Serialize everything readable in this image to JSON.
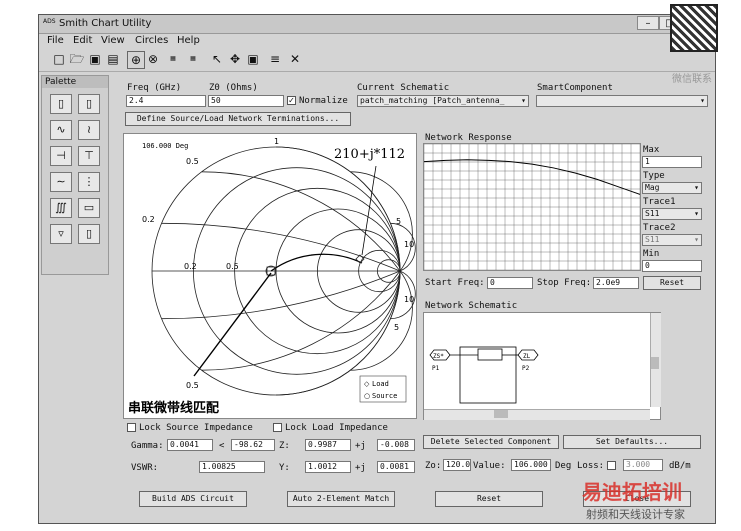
{
  "window": {
    "title": "Smith Chart Utility",
    "logo_text": "ADS"
  },
  "menu": [
    "File",
    "Edit",
    "View",
    "Circles",
    "Help"
  ],
  "palette": {
    "title": "Palette"
  },
  "freq": {
    "label": "Freq (GHz)",
    "value": "2.4"
  },
  "z0": {
    "label": "Z0 (Ohms)",
    "value": "50"
  },
  "normalize": {
    "label": "Normalize",
    "checked": true
  },
  "schematic": {
    "label": "Current Schematic",
    "value": "patch_matching [Patch_antenna_"
  },
  "smart_component": {
    "label": "SmartComponent",
    "value": ""
  },
  "define_button": "Define Source/Load Network Terminations...",
  "smith": {
    "deg_label": "106.000 Deg",
    "labels": [
      "0.5",
      "1",
      "0.2",
      "0.2",
      "0.5",
      "5",
      "10",
      "10",
      "5",
      "0.5"
    ],
    "annotation": "210+j*112",
    "caption": "串联微带线匹配",
    "legend": [
      "Load",
      "Source"
    ]
  },
  "network_response": {
    "title": "Network Response",
    "max_label": "Max",
    "max_value": "1",
    "type_label": "Type",
    "type_value": "Mag",
    "trace1_label": "Trace1",
    "trace1_value": "S11",
    "trace2_label": "Trace2",
    "trace2_value": "S11",
    "min_label": "Min",
    "min_value": "0",
    "start_label": "Start Freq:",
    "start_value": "0",
    "stop_label": "Stop Freq:",
    "stop_value": "2.0e9",
    "reset_label": "Reset"
  },
  "network_schematic": {
    "title": "Network Schematic",
    "p1_label": "ZS*",
    "p1_name": "P1",
    "p2_label": "ZL",
    "p2_name": "P2"
  },
  "lock_source": "Lock Source Impedance",
  "lock_load": "Lock Load Impedance",
  "gamma": {
    "label": "Gamma:",
    "mag": "0.0041",
    "angle_symbol": "<",
    "angle": "-98.62"
  },
  "z_values": {
    "label": "Z:",
    "real": "0.9987",
    "j": "+j",
    "imag": "-0.008"
  },
  "vswr": {
    "label": "VSWR:",
    "value": "1.00825"
  },
  "y_values": {
    "label": "Y:",
    "real": "1.0012",
    "j": "+j",
    "imag": "0.0081"
  },
  "delete_button": "Delete Selected Component",
  "defaults_button": "Set Defaults...",
  "component": {
    "zo_label": "Zo:",
    "zo_value": "120.0",
    "value_label": "Value:",
    "value": "106.000",
    "unit": "Deg",
    "loss_label": "Loss:",
    "loss_value": "3.000",
    "loss_unit": "dB/m"
  },
  "bottom": {
    "build": "Build ADS Circuit",
    "auto": "Auto 2-Element Match",
    "reset": "Reset",
    "close": "Close"
  },
  "watermarks": {
    "top_right": "微信联系",
    "brand": "易迪拓培训",
    "brand_sub": "射频和天线设计专家"
  },
  "chart_data": {
    "type": "line",
    "series": [
      {
        "x": [
          0,
          0.1,
          0.2,
          0.3,
          0.4,
          0.5,
          0.6,
          0.7,
          0.8,
          0.9,
          1.0
        ],
        "y": [
          0.86,
          0.87,
          0.875,
          0.87,
          0.86,
          0.84,
          0.81,
          0.77,
          0.72,
          0.66,
          0.6
        ]
      }
    ],
    "xlim": [
      0,
      1
    ],
    "ylim": [
      0,
      1
    ],
    "grid": true
  },
  "colors": {
    "window_bg": "#d4d4d4",
    "close_red": "#c94b3c",
    "brand_red": "#d9302a"
  }
}
